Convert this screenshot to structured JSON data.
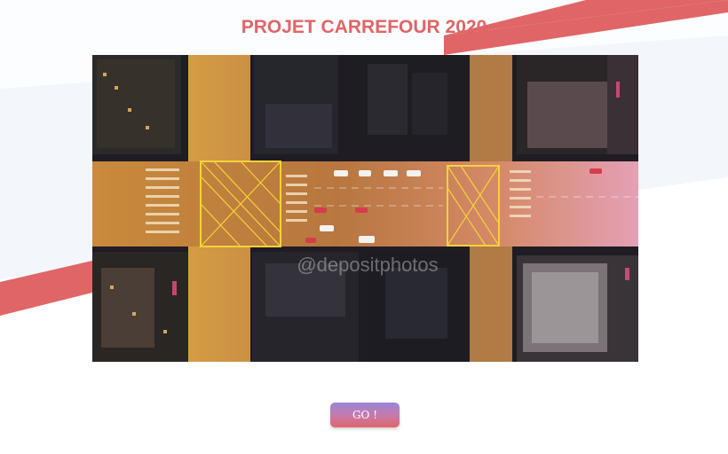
{
  "page": {
    "title": "PROJET CARREFOUR 2020"
  },
  "hero": {
    "image_name": "aerial-city-intersection-night",
    "watermark": "@depositphotos"
  },
  "actions": {
    "go_label": "GO !"
  },
  "colors": {
    "accent": "#e06567",
    "panel": "#eef2f7",
    "button_top": "#9a86d6",
    "button_bottom": "#e0656a"
  }
}
